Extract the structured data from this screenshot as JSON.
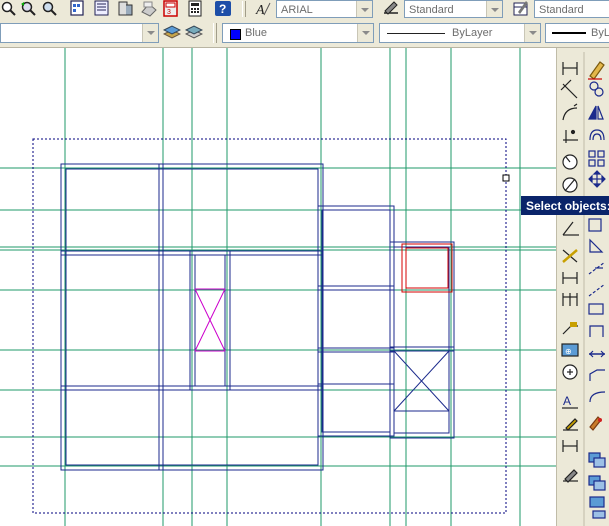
{
  "toolbar_top": {
    "text_style": "ARIAL",
    "dim_style": "Standard",
    "table_style": "Standard"
  },
  "toolbar_properties": {
    "color": "Blue",
    "color_swatch": "#0000ff",
    "linetype": "ByLayer",
    "lineweight": "ByL"
  },
  "tooltip": {
    "text": "Select objects:"
  },
  "colors": {
    "grid": "#1f9a6a",
    "wall": "#1b2a8c",
    "selection": "#00007f",
    "magenta": "#cc00cc",
    "red": "#d40000"
  },
  "icons_top": [
    "zoom-realtime-icon",
    "zoom-previous-icon",
    "zoom-window-icon",
    "sheet-set-icon",
    "markup-icon",
    "toolpalette-icon",
    "qcalc-icon",
    "calculator-icon",
    "help-icon"
  ],
  "icons_right_col1": [
    "linear-dim-icon",
    "aligned-dim-icon",
    "arc-length-icon",
    "ordinate-dim-icon",
    "radius-dim-icon",
    "diameter-dim-icon",
    "angular-dim-icon",
    "quick-dim-icon",
    "baseline-dim-icon",
    "continue-dim-icon",
    "leader-icon",
    "tolerance-icon",
    "center-mark-icon",
    "dim-edit-icon",
    "dim-text-edit-icon",
    "dim-update-icon",
    "dim-style-icon"
  ],
  "icons_right_col2": [
    "erase-icon",
    "copy-icon",
    "mirror-icon",
    "offset-icon",
    "array-icon",
    "move-icon",
    "rotate-icon",
    "scale-icon",
    "stretch-icon",
    "trim-icon",
    "extend-icon",
    "break-icon",
    "join-icon",
    "chamfer-icon",
    "fillet-icon",
    "explode-icon",
    "draworder-icon",
    "layers-icon",
    "properties-icon"
  ]
}
